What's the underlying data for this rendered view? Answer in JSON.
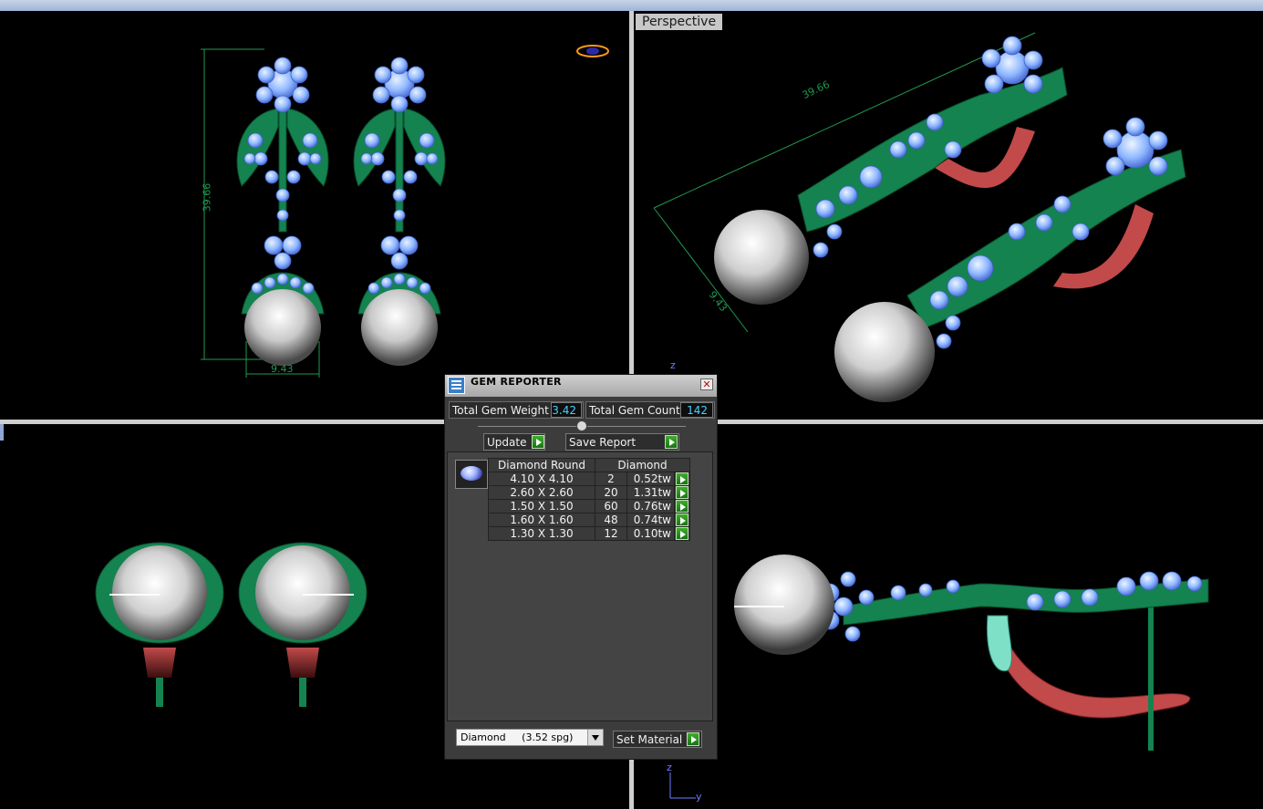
{
  "viewports": {
    "top_right_label": "Perspective"
  },
  "dimensions": {
    "front_height": "39.66",
    "front_width": "9.43",
    "persp_length": "39.66",
    "persp_width": "9.43"
  },
  "axes": {
    "z": "z",
    "y": "y"
  },
  "gem_reporter": {
    "title": "GEM REPORTER",
    "close_glyph": "✕",
    "total_weight_label": "Total Gem Weight",
    "total_weight_value": "3.42",
    "total_count_label": "Total Gem Count",
    "total_count_value": "142",
    "update_label": "Update",
    "save_label": "Save Report",
    "table": {
      "headers": [
        "Diamond Round",
        "Diamond"
      ],
      "rows": [
        {
          "size": "4.10 X 4.10",
          "count": "2",
          "weight": "0.52tw"
        },
        {
          "size": "2.60 X 2.60",
          "count": "20",
          "weight": "1.31tw"
        },
        {
          "size": "1.50 X 1.50",
          "count": "60",
          "weight": "0.76tw"
        },
        {
          "size": "1.60 X 1.60",
          "count": "48",
          "weight": "0.74tw"
        },
        {
          "size": "1.30 X 1.30",
          "count": "12",
          "weight": "0.10tw"
        }
      ]
    },
    "material_select": "Diamond     (3.52 spg)",
    "set_material_label": "Set Material"
  },
  "colors": {
    "metal_green": "#14834f",
    "gem_blue": "#8fb8ff",
    "pearl": "#e8e8e8",
    "red_metal": "#c24a4a",
    "dimension_line": "#1f9a50"
  }
}
